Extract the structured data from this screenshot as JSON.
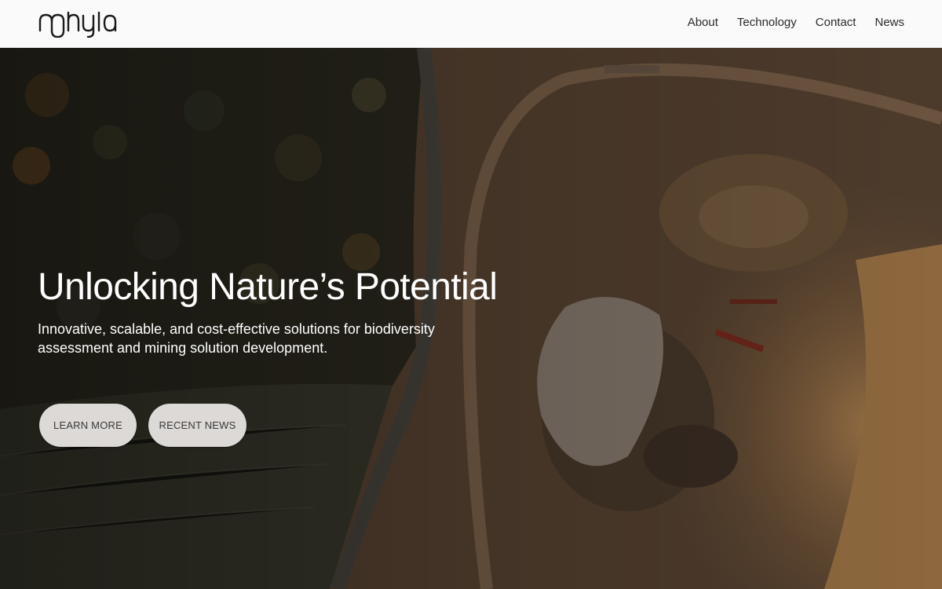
{
  "brand": {
    "logo_text": "nphyla"
  },
  "nav": {
    "items": [
      {
        "label": "About"
      },
      {
        "label": "Technology"
      },
      {
        "label": "Contact"
      },
      {
        "label": "News"
      }
    ]
  },
  "hero": {
    "title": "Unlocking Nature’s Potential",
    "subtitle": "Innovative, scalable, and cost-effective solutions for biodiversity assessment and mining solution development.",
    "buttons": {
      "learn_more": "LEARN MORE",
      "recent_news": "RECENT NEWS"
    },
    "background_image": "aerial-view-forest-and-quarry"
  },
  "colors": {
    "header_bg": "#fafafa",
    "nav_text": "#2b2b2b",
    "hero_text": "#ffffff",
    "button_bg": "#dcd9d6",
    "button_text": "#3a3a3a"
  }
}
